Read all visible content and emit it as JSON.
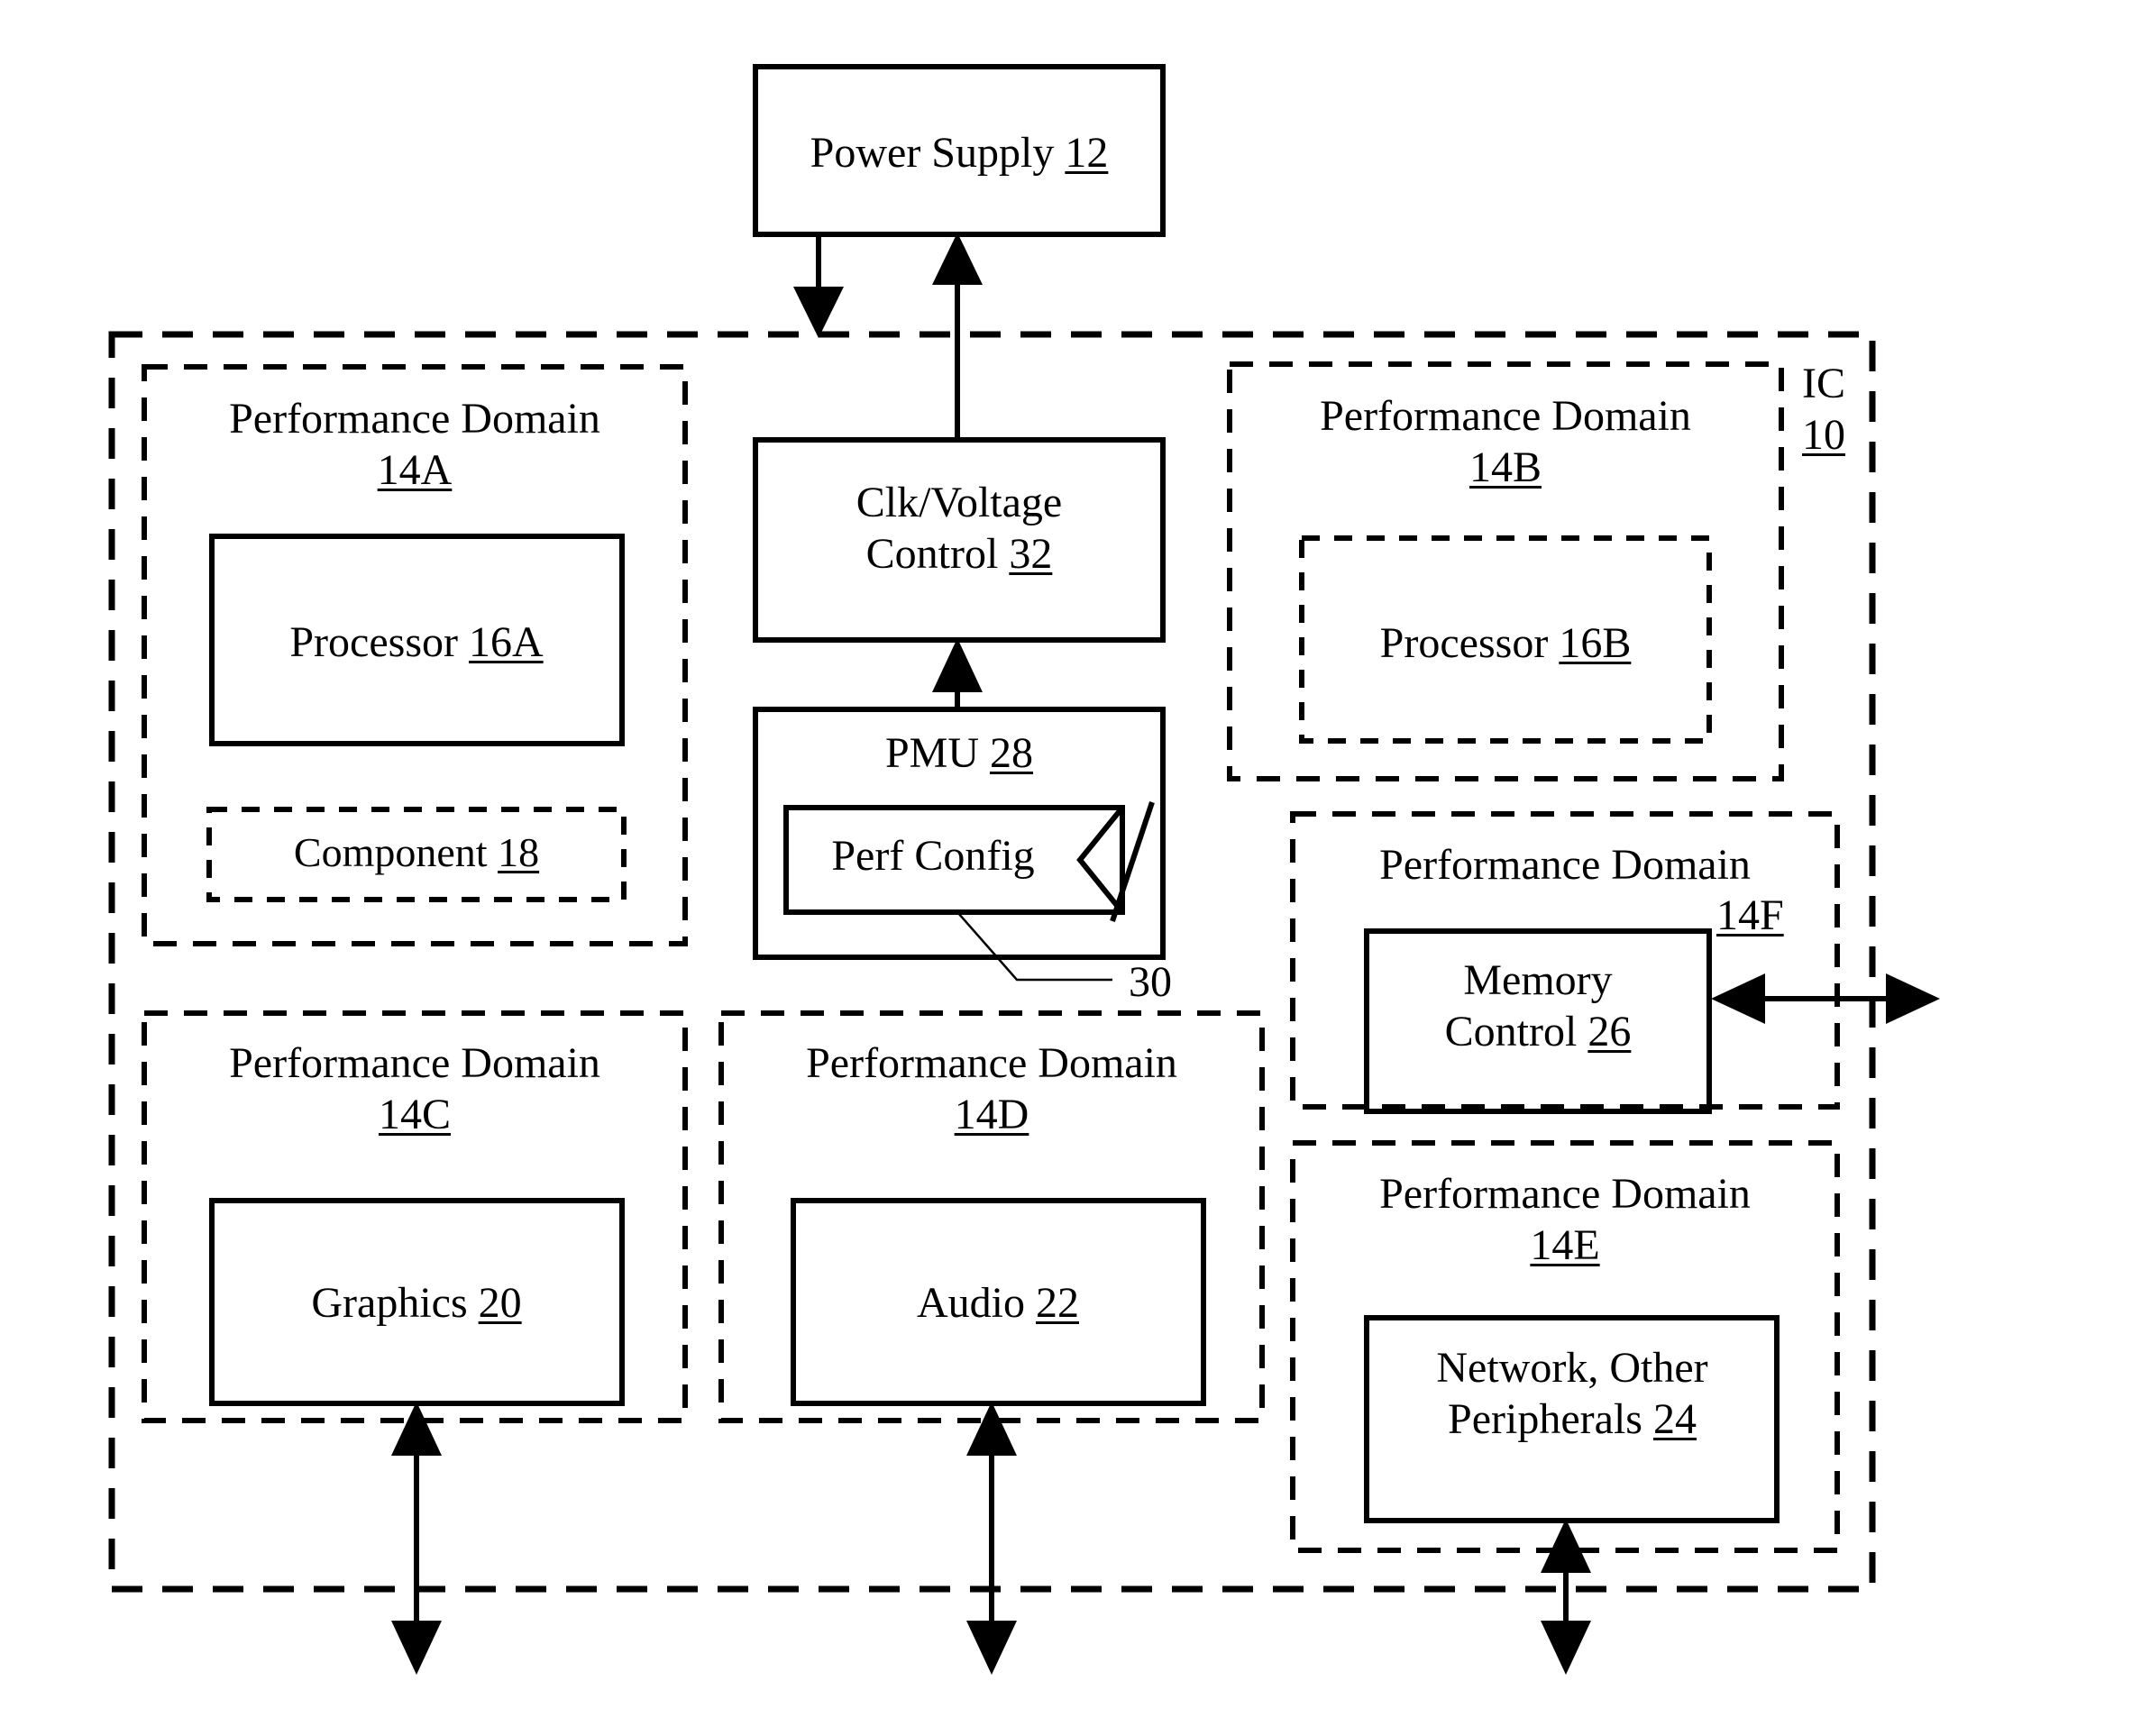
{
  "figure": {
    "title": "Integrated circuit performance domain block diagram",
    "line_color": "#000000",
    "background": "#ffffff"
  },
  "power_supply": {
    "label": "Power Supply",
    "ref": "12"
  },
  "ic": {
    "label": "IC",
    "ref": "10"
  },
  "center_column": {
    "clk_voltage_control": {
      "line1": "Clk/Voltage",
      "line2_text": "Control",
      "line2_ref": "32"
    },
    "pmu": {
      "label": "PMU",
      "ref": "28"
    },
    "perf_config": {
      "label": "Perf Config",
      "callout_ref": "30"
    }
  },
  "domains": [
    {
      "key": "14A",
      "title": "Performance Domain",
      "ref": "14A",
      "ref_align": "center",
      "children": [
        {
          "key": "processor-16a",
          "label": "Processor",
          "ref": "16A",
          "border": "solid"
        },
        {
          "key": "component-18",
          "label": "Component",
          "ref": "18",
          "border": "dashed"
        }
      ]
    },
    {
      "key": "14B",
      "title": "Performance Domain",
      "ref": "14B",
      "ref_align": "center",
      "children": [
        {
          "key": "processor-16b",
          "label": "Processor",
          "ref": "16B",
          "border": "dashed"
        }
      ]
    },
    {
      "key": "14C",
      "title": "Performance Domain",
      "ref": "14C",
      "ref_align": "center",
      "children": [
        {
          "key": "graphics-20",
          "label": "Graphics",
          "ref": "20",
          "border": "solid"
        }
      ]
    },
    {
      "key": "14D",
      "title": "Performance Domain",
      "ref": "14D",
      "ref_align": "center",
      "children": [
        {
          "key": "audio-22",
          "label": "Audio",
          "ref": "22",
          "border": "solid"
        }
      ]
    },
    {
      "key": "14E",
      "title": "Performance Domain",
      "ref": "14E",
      "ref_align": "center",
      "children": [
        {
          "key": "network-peripherals-24",
          "line1": "Network, Other",
          "line2_text": "Peripherals",
          "ref": "24",
          "border": "solid"
        }
      ]
    },
    {
      "key": "14F",
      "title": "Performance Domain",
      "ref": "14F",
      "ref_align": "right",
      "children": [
        {
          "key": "memory-control-26",
          "line1": "Memory",
          "line2_text": "Control",
          "ref": "26",
          "border": "solid"
        }
      ]
    }
  ],
  "connections": [
    {
      "key": "power-to-ic",
      "from": "power_supply",
      "to": "ic",
      "direction": "down"
    },
    {
      "key": "clk-to-power",
      "from": "clk_voltage_control",
      "to": "power_supply",
      "direction": "up"
    },
    {
      "key": "pmu-to-clk",
      "from": "pmu",
      "to": "clk_voltage_control",
      "direction": "up"
    },
    {
      "key": "memory-external",
      "from": "memory_control_26",
      "to": "external",
      "direction": "bidirectional"
    },
    {
      "key": "graphics-external",
      "from": "graphics_20",
      "to": "external",
      "direction": "bidirectional"
    },
    {
      "key": "audio-external",
      "from": "audio_22",
      "to": "external",
      "direction": "bidirectional"
    },
    {
      "key": "network-external",
      "from": "network_peripherals_24",
      "to": "external",
      "direction": "bidirectional"
    }
  ]
}
